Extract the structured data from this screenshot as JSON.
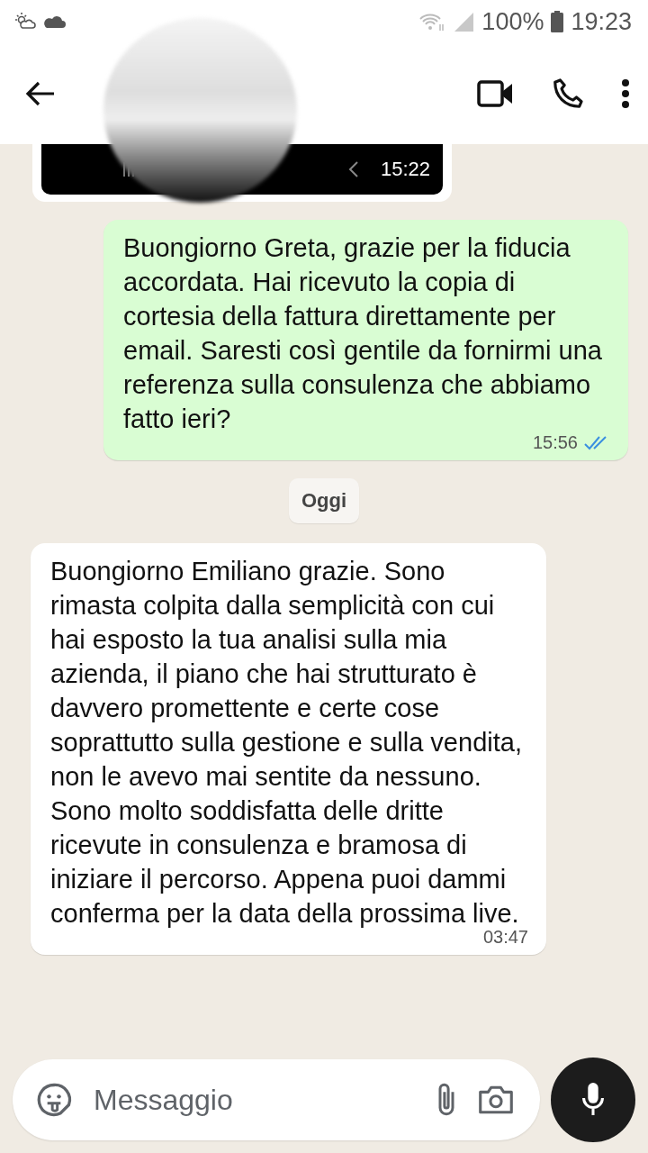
{
  "status_bar": {
    "battery": "100%",
    "time": "19:23"
  },
  "media_message": {
    "time": "15:22"
  },
  "messages": [
    {
      "kind": "sent",
      "text": "Buongiorno Greta, grazie per la fiducia accordata. Hai ricevuto la copia di cortesia della fattura direttamente per email. Saresti così gentile da fornirmi una referenza sulla consulenza che abbiamo fatto ieri?",
      "time": "15:56",
      "read": true
    },
    {
      "kind": "date",
      "text": "Oggi"
    },
    {
      "kind": "received",
      "text": "Buongiorno Emiliano grazie. Sono rimasta colpita dalla semplicità con cui hai esposto la tua analisi sulla mia azienda, il piano che hai strutturato è davvero promettente e certe cose soprattutto sulla gestione e sulla vendita, non le avevo mai sentite da nessuno. Sono molto soddisfatta delle dritte ricevute in consulenza e bramosa di iniziare il percorso. Appena puoi dammi conferma per la data della prossima live.",
      "time": "03:47"
    }
  ],
  "composer": {
    "placeholder": "Messaggio"
  }
}
